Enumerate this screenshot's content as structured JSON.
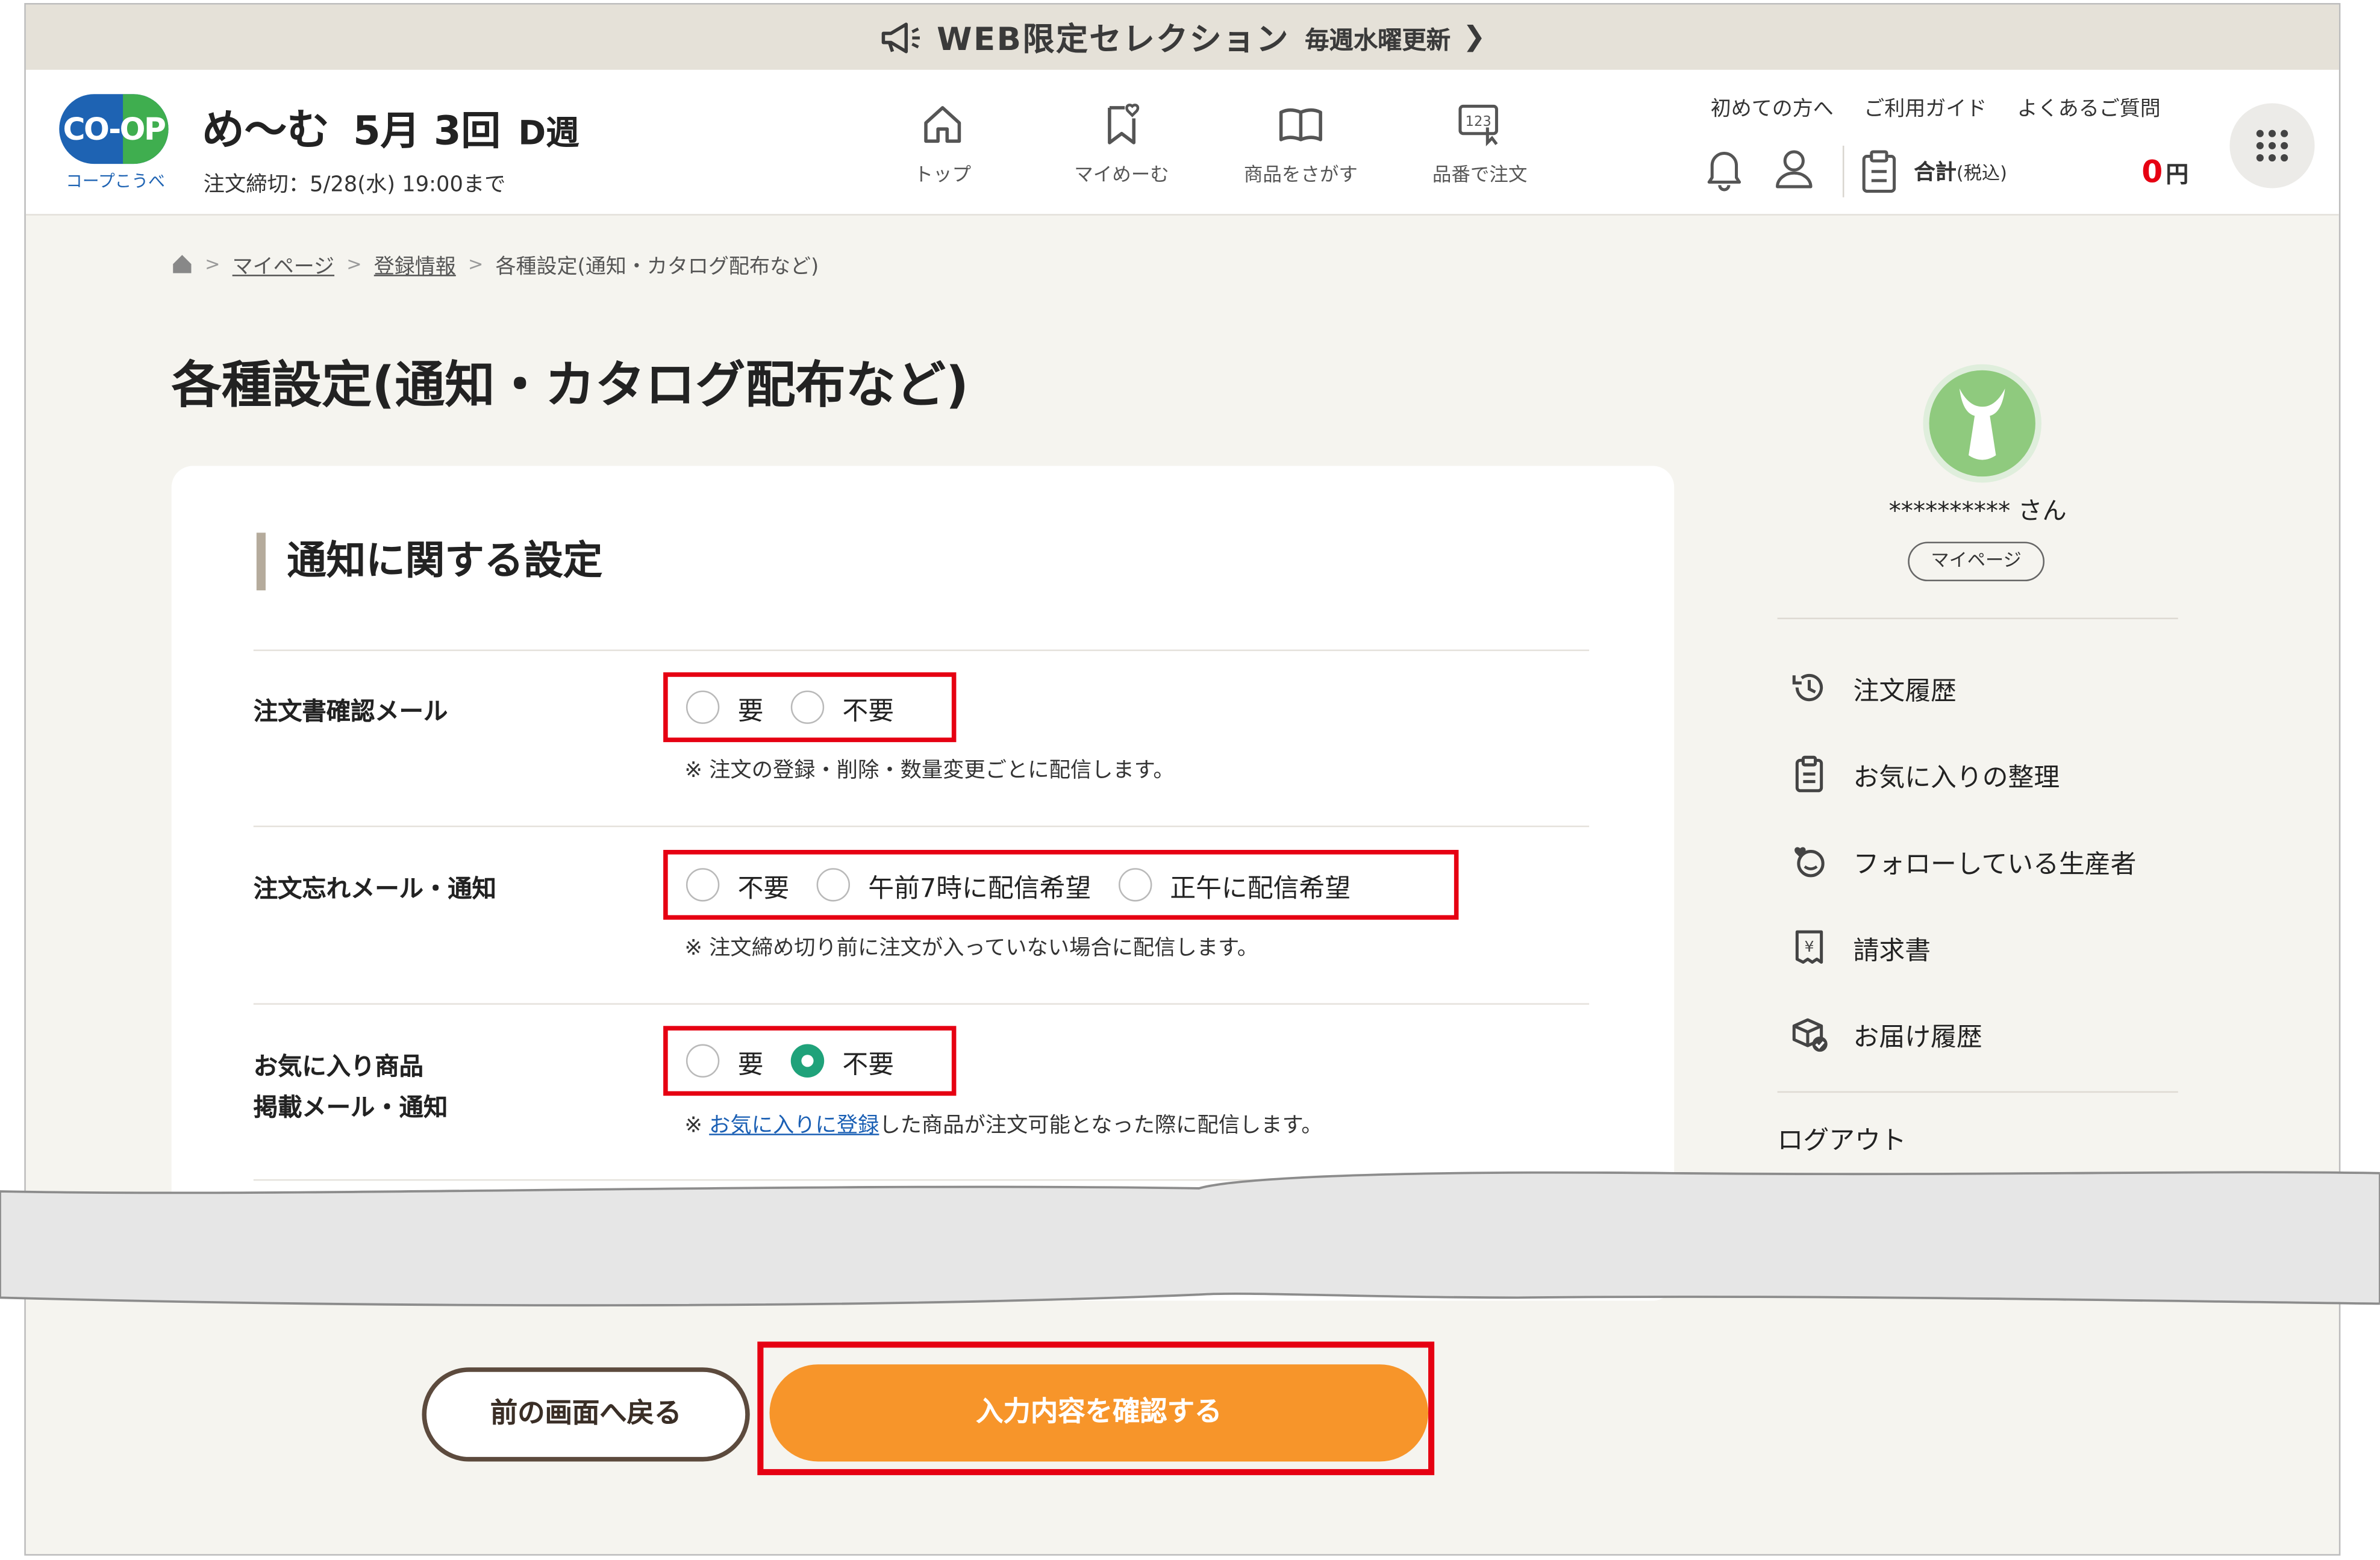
{
  "promo": {
    "text": "WEB限定セレクション",
    "sub": "毎週水曜更新"
  },
  "header": {
    "logo_text": "CO-OP",
    "logo_sub": "コープこうべ",
    "brand_name": "め〜む",
    "week": "5月 3回",
    "week_suffix": "D週",
    "deadline": "注文締切：5/28(水) 19:00まで",
    "nav": [
      {
        "label": "トップ",
        "icon": "home-icon"
      },
      {
        "label": "マイめーむ",
        "icon": "bookmark-heart-icon"
      },
      {
        "label": "商品をさがす",
        "icon": "book-icon"
      },
      {
        "label": "品番で注文",
        "icon": "number-input-icon"
      }
    ],
    "util_links": [
      "初めての方へ",
      "ご利用ガイド",
      "よくあるご質問"
    ],
    "total_label": "合計",
    "total_tax": "(税込)",
    "total_value": "0",
    "total_unit": "円"
  },
  "breadcrumb": {
    "items": [
      "マイページ",
      "登録情報",
      "各種設定(通知・カタログ配布など)"
    ]
  },
  "page_title": "各種設定(通知・カタログ配布など)",
  "section": {
    "title": "通知に関する設定",
    "rows": [
      {
        "label": "注文書確認メール",
        "options": [
          "要",
          "不要"
        ],
        "selected": null,
        "note": "※ 注文の登録・削除・数量変更ごとに配信します。"
      },
      {
        "label": "注文忘れメール・通知",
        "options": [
          "不要",
          "午前7時に配信希望",
          "正午に配信希望"
        ],
        "selected": null,
        "note": "※ 注文締め切り前に注文が入っていない場合に配信します。"
      },
      {
        "label_line1": "お気に入り商品",
        "label_line2": "掲載メール・通知",
        "options": [
          "要",
          "不要"
        ],
        "selected": "不要",
        "note_prefix": "※ ",
        "note_link": "お気に入りに登録",
        "note_suffix": "した商品が注文可能となった際に配信します。"
      }
    ]
  },
  "sidebar": {
    "user_name": "********** さん",
    "mypage_button": "マイページ",
    "items": [
      {
        "label": "注文履歴",
        "icon": "history-icon"
      },
      {
        "label": "お気に入りの整理",
        "icon": "clipboard-icon"
      },
      {
        "label": "フォローしている生産者",
        "icon": "producer-heart-icon"
      },
      {
        "label": "請求書",
        "icon": "invoice-yen-icon"
      },
      {
        "label": "お届け履歴",
        "icon": "box-check-icon"
      }
    ],
    "logout": "ログアウト"
  },
  "buttons": {
    "back": "前の画面へ戻る",
    "confirm": "入力内容を確認する"
  },
  "colors": {
    "accent": "#f7952a",
    "highlight": "#e60012",
    "radio_on": "#1fa27a",
    "link": "#1a5fb4"
  }
}
